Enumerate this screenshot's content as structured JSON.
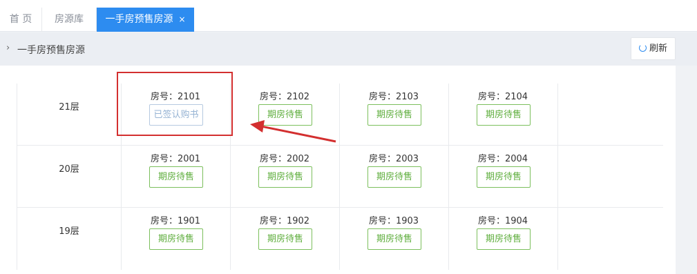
{
  "tabs": {
    "home": "首 页",
    "library": "房源库",
    "active": "一手房预售房源",
    "close": "×"
  },
  "breadcrumb": {
    "chevron": "›",
    "text": "一手房预售房源"
  },
  "refresh_label": "刷新",
  "floors": [
    {
      "label": "21层",
      "units": [
        {
          "number": "房号：2101",
          "status": "已签认购书",
          "type": "signed"
        },
        {
          "number": "房号：2102",
          "status": "期房待售",
          "type": "presale"
        },
        {
          "number": "房号：2103",
          "status": "期房待售",
          "type": "presale"
        },
        {
          "number": "房号：2104",
          "status": "期房待售",
          "type": "presale"
        }
      ]
    },
    {
      "label": "20层",
      "units": [
        {
          "number": "房号：2001",
          "status": "期房待售",
          "type": "presale"
        },
        {
          "number": "房号：2002",
          "status": "期房待售",
          "type": "presale"
        },
        {
          "number": "房号：2003",
          "status": "期房待售",
          "type": "presale"
        },
        {
          "number": "房号：2004",
          "status": "期房待售",
          "type": "presale"
        }
      ]
    },
    {
      "label": "19层",
      "units": [
        {
          "number": "房号：1901",
          "status": "期房待售",
          "type": "presale"
        },
        {
          "number": "房号：1902",
          "status": "期房待售",
          "type": "presale"
        },
        {
          "number": "房号：1903",
          "status": "期房待售",
          "type": "presale"
        },
        {
          "number": "房号：1904",
          "status": "期房待售",
          "type": "presale"
        }
      ]
    }
  ],
  "colors": {
    "accent": "#2d8cf0",
    "presale": "#5fae3e",
    "signed": "#97b4d4",
    "annotation": "#d32f2f"
  }
}
